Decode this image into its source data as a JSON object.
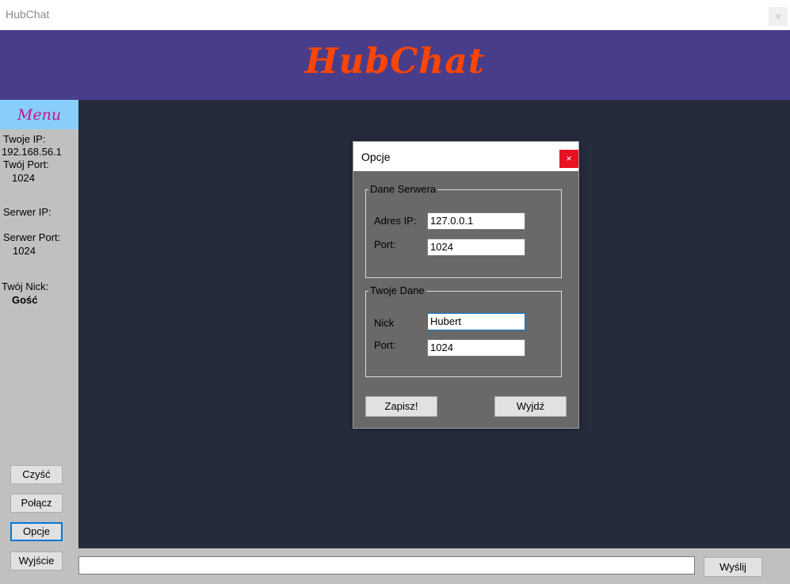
{
  "window": {
    "title": "HubChat",
    "close_glyph": "×"
  },
  "banner": {
    "logo_text": "HubChat"
  },
  "sidebar": {
    "menu_title": "Menu",
    "your_ip_label": "Twoje IP:",
    "your_ip_value": "192.168.56.1",
    "your_port_label": "Twój Port:",
    "your_port_value": "1024",
    "server_ip_label": "Serwer IP:",
    "server_port_label": "Serwer Port:",
    "server_port_value": "1024",
    "nick_label": "Twój Nick:",
    "nick_value": "Gość",
    "buttons": {
      "clear": "Czyść",
      "connect": "Połącz",
      "options": "Opcje",
      "exit": "Wyjście"
    }
  },
  "chat": {
    "message_value": "",
    "send_label": "Wyślij"
  },
  "dialog": {
    "title": "Opcje",
    "close_glyph": "×",
    "server_group": {
      "legend": "Dane Serwera",
      "ip_label": "Adres IP:",
      "ip_value": "127.0.0.1",
      "port_label": "Port:",
      "port_value": "1024"
    },
    "user_group": {
      "legend": "Twoje Dane",
      "nick_label": "Nick",
      "nick_value": "Hubert",
      "port_label": "Port:",
      "port_value": "1024"
    },
    "save_label": "Zapisz!",
    "exit_label": "Wyjdź"
  },
  "colors": {
    "banner": "#483d8b",
    "logo": "#ff4500",
    "menu_header": "#87cefa",
    "menu_title": "#c71585",
    "sidebar": "#c0c0c0",
    "chat_background": "#262b3c",
    "dialog_background": "#696969",
    "close_button": "#e81123",
    "focus_border": "#0078d7"
  }
}
